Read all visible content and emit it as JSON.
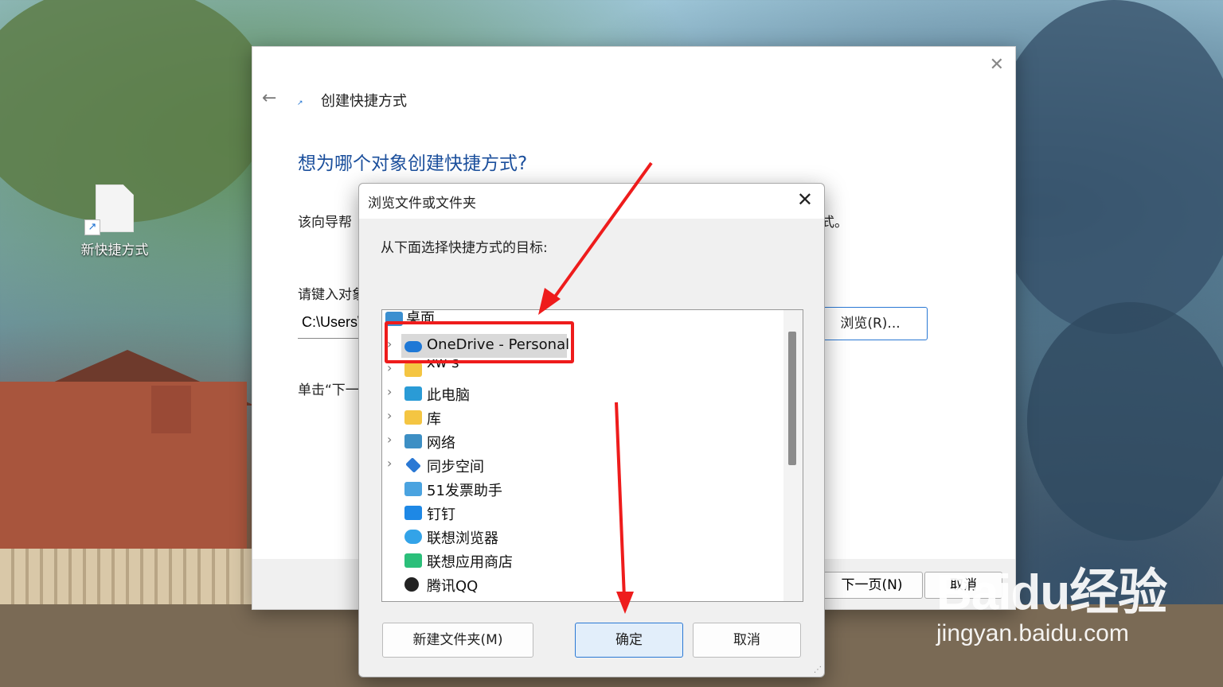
{
  "desktop": {
    "icon_label": "新快捷方式"
  },
  "wizard": {
    "title": "创建快捷方式",
    "heading": "想为哪个对象创建快捷方式?",
    "description_start": "该向导帮",
    "description_end": "式。",
    "prompt": "请键入对象",
    "input_value": "C:\\Users\\",
    "browse_button": "浏览(R)...",
    "click_hint": "单击“下一",
    "next_button": "下一页(N)",
    "cancel_button": "取消"
  },
  "dialog": {
    "title": "浏览文件或文件夹",
    "prompt": "从下面选择快捷方式的目标:",
    "tree_items": [
      {
        "label": "桌面",
        "icon": "desktop-folder-icon",
        "expandable": false
      },
      {
        "label": "OneDrive - Personal",
        "icon": "onedrive-cloud-icon",
        "expandable": true,
        "selected": true
      },
      {
        "label": "xw s",
        "icon": "user-folder-icon",
        "expandable": true
      },
      {
        "label": "此电脑",
        "icon": "computer-icon",
        "expandable": true
      },
      {
        "label": "库",
        "icon": "library-folder-icon",
        "expandable": true
      },
      {
        "label": "网络",
        "icon": "network-icon",
        "expandable": true
      },
      {
        "label": "同步空间",
        "icon": "sync-space-icon",
        "expandable": true
      },
      {
        "label": "51发票助手",
        "icon": "invoice-app-icon",
        "expandable": false
      },
      {
        "label": "钉钉",
        "icon": "dingtalk-icon",
        "expandable": false
      },
      {
        "label": "联想浏览器",
        "icon": "lenovo-browser-icon",
        "expandable": false
      },
      {
        "label": "联想应用商店",
        "icon": "lenovo-store-icon",
        "expandable": false
      },
      {
        "label": "腾讯QQ",
        "icon": "qq-penguin-icon",
        "expandable": false
      }
    ],
    "new_folder_button": "新建文件夹(M)",
    "ok_button": "确定",
    "cancel_button": "取消"
  },
  "watermark": {
    "logo": "Baidu经验",
    "url": "jingyan.baidu.com"
  },
  "colors": {
    "accent": "#2a78d4",
    "heading": "#1b4f9c",
    "annotation_red": "#ee1c1c"
  }
}
